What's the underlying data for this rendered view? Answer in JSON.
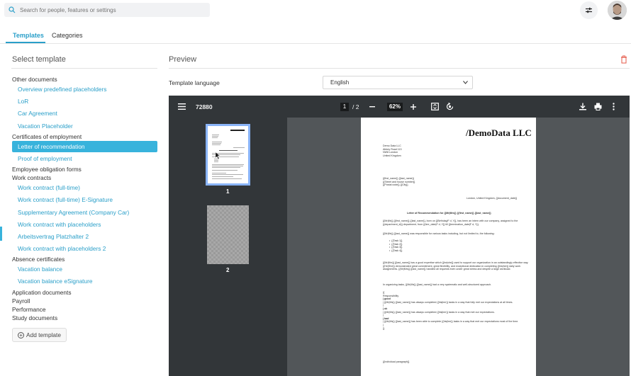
{
  "search": {
    "placeholder": "Search for people, features or settings"
  },
  "tabs": [
    {
      "label": "Templates"
    },
    {
      "label": "Categories"
    }
  ],
  "left": {
    "title": "Select template",
    "tree": [
      {
        "type": "cat",
        "label": "Other documents"
      },
      {
        "type": "item",
        "label": "Overview predefined placeholders"
      },
      {
        "type": "item",
        "label": "LoR"
      },
      {
        "type": "item",
        "label": "Car Agreement"
      },
      {
        "type": "item",
        "label": "Vacation Placeholder"
      },
      {
        "type": "cat",
        "label": "Certificates of employment"
      },
      {
        "type": "item",
        "label": "Letter of recommendation",
        "selected": true
      },
      {
        "type": "item",
        "label": "Proof of employment"
      },
      {
        "type": "cat",
        "label": "Employee obligation forms"
      },
      {
        "type": "cat",
        "label": "Work contracts"
      },
      {
        "type": "item",
        "label": "Work contract (full-time)"
      },
      {
        "type": "item",
        "label": "Work contract (full-time) E-Signature"
      },
      {
        "type": "item",
        "label": "Supplementary Agreement (Company Car)"
      },
      {
        "type": "item",
        "label": "Work contract with placeholders"
      },
      {
        "type": "item",
        "label": "Arbeitsvertrag Platzhalter 2"
      },
      {
        "type": "item",
        "label": "Work contract with placeholders 2"
      },
      {
        "type": "cat",
        "label": "Absence certificates"
      },
      {
        "type": "item",
        "label": "Vacation balance"
      },
      {
        "type": "item",
        "label": "Vacation balance eSignature"
      },
      {
        "type": "cat",
        "label": "Application documents"
      },
      {
        "type": "cat",
        "label": "Payroll"
      },
      {
        "type": "cat",
        "label": "Performance"
      },
      {
        "type": "cat",
        "label": "Study documents"
      }
    ],
    "add_label": "Add template"
  },
  "right": {
    "title": "Preview",
    "lang_label": "Template language",
    "lang_value": "English"
  },
  "viewer": {
    "doc_name": "72880",
    "page_current": "1",
    "page_total": "/ 2",
    "zoom": "62%",
    "thumb_labels": [
      "1",
      "2"
    ]
  },
  "letter": {
    "logo": "/DemoData LLC",
    "sender": [
      "Demo Data LLC",
      "Abbey Road 113",
      "NW8 London",
      "United Kingdom"
    ],
    "recipient": [
      "{{first_name}} {{last_name}}",
      "{{Street and house number}}",
      "{{Postal code}} {{City}}"
    ],
    "place_date": "London, United Kingdom, {{document_date}}",
    "subject": "Letter of Recommendation for {{Mr|Mrs}} {{first_name}} {{last_name}}",
    "p1": "{{Mr|Ms}} {{first_name}} {{last_name}}, born on {{Birthday|F d, Y}}, has been an intern with our company, assigned to the {{department_id}} department, from {{hire_date|F d, Y}} till {{termination_date|F d, Y}}.",
    "p2": "{{Mr|Ms}} {{last_name}} was responsible for various tasks including, but not limited to, the following:",
    "tasks": [
      "{{Task 1}}",
      "{{Task 2}}",
      "{{Task 3}}",
      "{{Task 4}}"
    ],
    "p3": "{{Mr|Mrs}} {{last_name}} has a good expertise which {{he|she}} used to support our organization in an outstandingly effective way. {{He|She}} demonstrated great commitment, great flexibility, and exceptional dedication in completing {{his|her}} daily work assignments. {{Mr|Mrs}} {{last_name}} handled all requests even under great stress and despite a large workload.",
    "p4": "In organizing tasks, {{Mr|Ms}} {{last_name}} had a very systematic and well-structured approach.",
    "p5": [
      "{{",
      "Responsibility",
      "| good",
      "| {{Mr|Ms}} {{last_name}} has always completed {{his|her}} tasks in a way that fully met our expectations at all times.",
      "|",
      "| ok",
      "| {{Mr|Ms}} {{last_name}} has always completed {{his|her}} tasks in a way that met our expectations.",
      "|",
      "| bad",
      "| {{Mr|Ms}} {{last_name}} has been able to complete {{his|her}} tasks in a way that met our expectations most of the time.",
      "|",
      "}}"
    ],
    "p6": "{{Individual paragraph}}"
  }
}
